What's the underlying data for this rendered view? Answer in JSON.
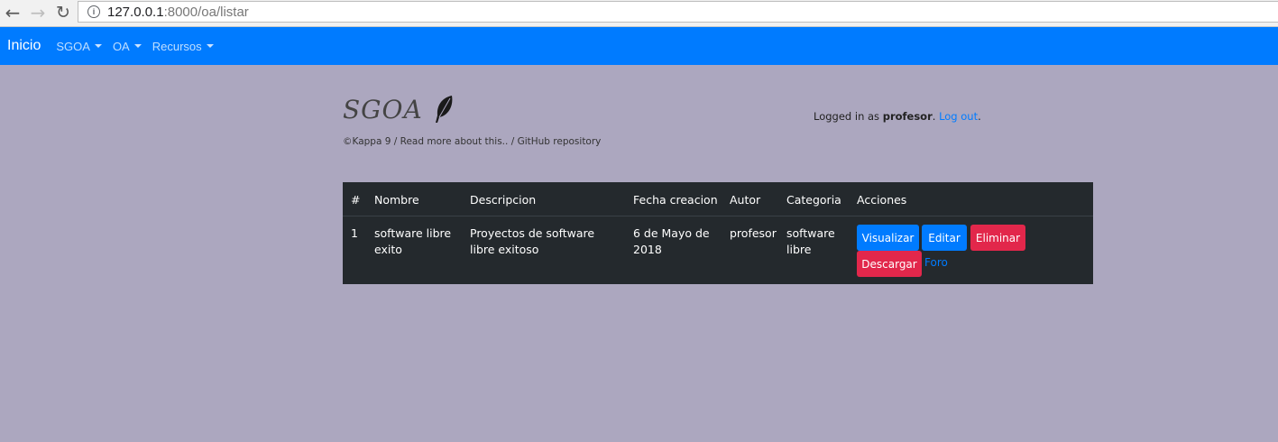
{
  "browser": {
    "url_host": "127.0.0.1",
    "url_rest": ":8000/oa/listar"
  },
  "navbar": {
    "brand": "Inicio",
    "items": [
      {
        "label": "SGOA"
      },
      {
        "label": "OA"
      },
      {
        "label": "Recursos"
      }
    ],
    "color": "#007bff"
  },
  "header": {
    "logo": "SGOA",
    "credits": "©Kappa 9 / Read more about this.. / GitHub repository",
    "login_prefix": "Logged in as",
    "username": "profesor",
    "login_period": ".",
    "logout_label": "Log out",
    "logout_period": "."
  },
  "table": {
    "columns": [
      "#",
      "Nombre",
      "Descripcion",
      "Fecha creacion",
      "Autor",
      "Categoria",
      "Acciones"
    ],
    "rows": [
      {
        "num": "1",
        "nombre": "software libre exito",
        "descripcion": "Proyectos de software libre exitoso",
        "fecha": "6 de Mayo de 2018",
        "autor": "profesor",
        "categoria": "software libre",
        "actions": {
          "visualizar": "Visualizar",
          "editar": "Editar",
          "eliminar": "Eliminar",
          "descargar": "Descargar",
          "foro": "Foro"
        }
      }
    ]
  },
  "colors": {
    "page_bg": "#aca7bf",
    "table_bg": "#24292d",
    "primary": "#007bff",
    "danger": "#e2274b"
  }
}
